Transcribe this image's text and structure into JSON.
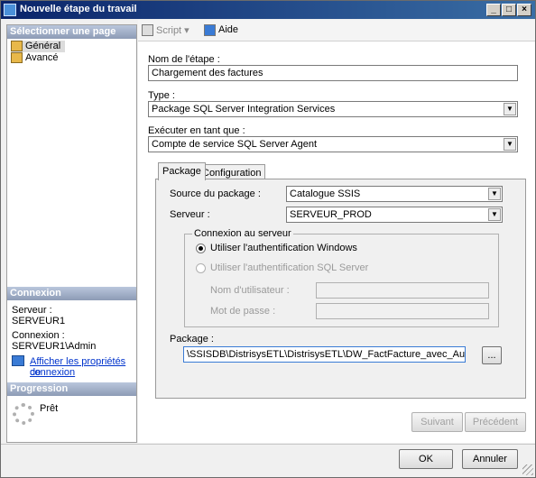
{
  "window": {
    "title": "Nouvelle étape du travail",
    "btn_min": "_",
    "btn_max": "□",
    "btn_close": "×"
  },
  "left": {
    "select_page_header": "Sélectionner une page",
    "pages": [
      {
        "label": "Général",
        "selected": true
      },
      {
        "label": "Avancé",
        "selected": false
      }
    ],
    "connection_header": "Connexion",
    "server_label": "Serveur :",
    "server_value": "SERVEUR1",
    "conn_label": "Connexion :",
    "conn_value": "SERVEUR1\\Admin",
    "props_link_1": "Afficher les propriétés de",
    "props_link_2": "connexion",
    "progress_header": "Progression",
    "progress_status": "Prêt"
  },
  "toolbar": {
    "script_label": "Script",
    "help_label": "Aide"
  },
  "form": {
    "step_name_label": "Nom de l'étape :",
    "step_name_value": "Chargement des factures",
    "type_label": "Type :",
    "type_value": "Package SQL Server Integration Services",
    "run_as_label": "Exécuter en tant que :",
    "run_as_value": "Compte de service SQL Server Agent"
  },
  "tabs": {
    "package": "Package",
    "configuration": "Configuration"
  },
  "package": {
    "source_label": "Source du package :",
    "source_value": "Catalogue SSIS",
    "server_label": "Serveur :",
    "server_value": "SERVEUR_PROD",
    "group_legend": "Connexion au serveur",
    "auth_windows": "Utiliser l'authentification Windows",
    "auth_sql": "Utiliser l'authentification SQL Server",
    "username_label": "Nom d'utilisateur :",
    "password_label": "Mot de passe :",
    "path_label": "Package :",
    "path_value": "\\SSISDB\\DistrisysETL\\DistrisysETL\\DW_FactFacture_avec_Audit.dtsx",
    "browse_label": "..."
  },
  "nav_buttons": {
    "next": "Suivant",
    "prev": "Précédent"
  },
  "footer": {
    "ok": "OK",
    "cancel": "Annuler"
  }
}
